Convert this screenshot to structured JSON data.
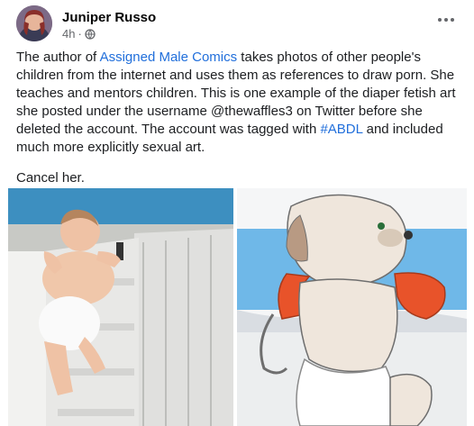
{
  "post": {
    "author": "Juniper Russo",
    "time": "4h",
    "privacy_icon": "globe-icon",
    "more_icon": "more-options-icon",
    "body": {
      "p1_before_link1": "The author of ",
      "link1": "Assigned Male Comics",
      "p1_after_link1": " takes photos of other people's children from the internet and uses them as references to draw porn. She teaches and mentors children. This is one example of the diaper fetish art she posted under the username @thewaffles3 on Twitter before she deleted the account. The account was tagged with ",
      "link2": "#ABDL",
      "p1_end": " and included much more explicitly sexual art.",
      "p2": "Cancel her."
    }
  },
  "colors": {
    "link": "#216fdb",
    "name": "#050505",
    "meta": "#65676b",
    "body_text": "#1c1e21"
  }
}
